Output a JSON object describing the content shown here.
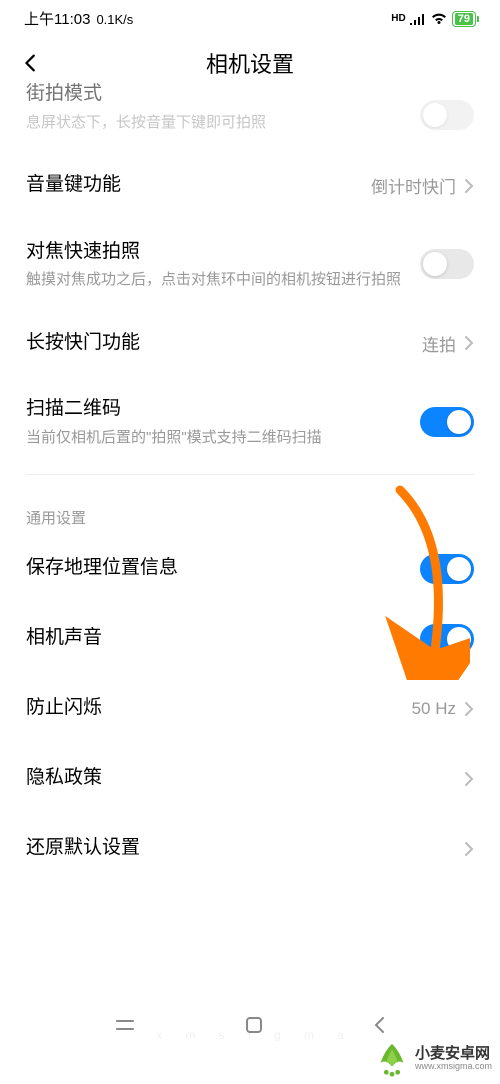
{
  "status": {
    "time": "上午11:03",
    "net_speed": "0.1K/s",
    "hd": "HD",
    "battery": "79"
  },
  "header": {
    "title": "相机设置"
  },
  "items": {
    "street_snap": {
      "title": "街拍模式",
      "desc": "息屏状态下，长按音量下键即可拍照"
    },
    "volume_key": {
      "title": "音量键功能",
      "value": "倒计时快门"
    },
    "focus_shoot": {
      "title": "对焦快速拍照",
      "desc": "触摸对焦成功之后，点击对焦环中间的相机按钮进行拍照"
    },
    "long_press": {
      "title": "长按快门功能",
      "value": "连拍"
    },
    "qr": {
      "title": "扫描二维码",
      "desc": "当前仅相机后置的\"拍照\"模式支持二维码扫描"
    }
  },
  "section": {
    "general": "通用设置"
  },
  "gen": {
    "location": {
      "title": "保存地理位置信息"
    },
    "sound": {
      "title": "相机声音"
    },
    "flicker": {
      "title": "防止闪烁",
      "value": "50 Hz"
    },
    "privacy": {
      "title": "隐私政策"
    },
    "reset": {
      "title": "还原默认设置"
    }
  },
  "watermark": {
    "cn": "小麦安卓网",
    "url": "www.xmsigma.com"
  },
  "sig": "x  m  s  i  g  m  a"
}
